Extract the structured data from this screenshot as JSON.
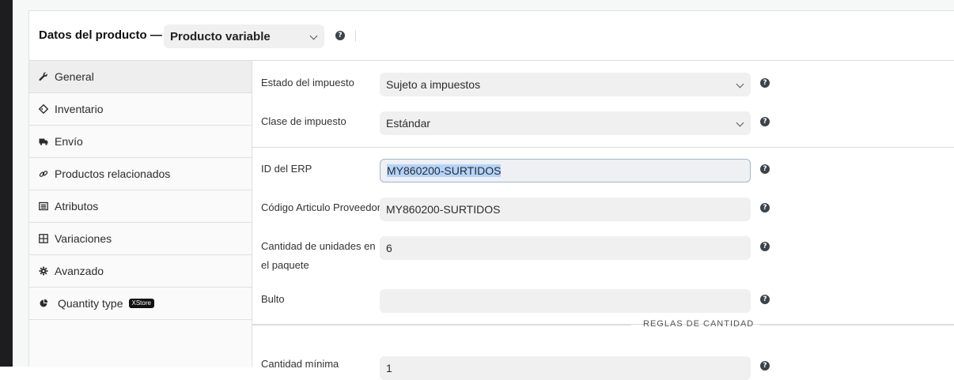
{
  "header": {
    "title": "Datos del producto —",
    "product_type": "Producto variable",
    "help_glyph": "?"
  },
  "tabs": [
    {
      "label": "General",
      "icon": "wrench-icon",
      "active": true
    },
    {
      "label": "Inventario",
      "icon": "tag-icon"
    },
    {
      "label": "Envío",
      "icon": "truck-icon"
    },
    {
      "label": "Productos relacionados",
      "icon": "link-icon"
    },
    {
      "label": "Atributos",
      "icon": "list-icon"
    },
    {
      "label": "Variaciones",
      "icon": "grid-icon"
    },
    {
      "label": "Avanzado",
      "icon": "gear-icon"
    },
    {
      "label": "Quantity type",
      "icon": "pie-icon",
      "badge": "XStore"
    }
  ],
  "fields": {
    "tax_status": {
      "label": "Estado del impuesto",
      "value": "Sujeto a impuestos"
    },
    "tax_class": {
      "label": "Clase de impuesto",
      "value": "Estándar"
    },
    "erp_id": {
      "label": "ID del ERP",
      "value": "MY860200-SURTIDOS"
    },
    "supplier_code": {
      "label": "Código Articulo Proveedor",
      "value": "MY860200-SURTIDOS"
    },
    "units_per_package": {
      "label_line1": "Cantidad de unidades en",
      "label_line2": "el paquete",
      "value": "6"
    },
    "bulto": {
      "label": "Bulto",
      "value": ""
    },
    "min_qty": {
      "label": "Cantidad mínima",
      "value": "1"
    }
  },
  "sections": {
    "quantity_rules": "REGLAS DE CANTIDAD"
  }
}
